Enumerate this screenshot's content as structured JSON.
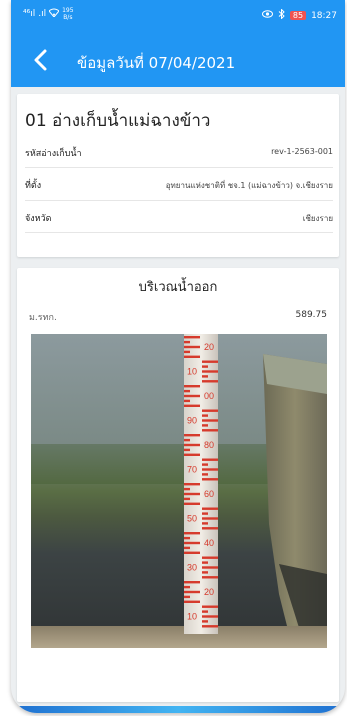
{
  "status_bar": {
    "signal1": "⁴⁶ıl",
    "signal2": ".ıl",
    "speed_value": "195",
    "speed_unit": "B/s",
    "battery": "85",
    "time": "18:27"
  },
  "header": {
    "title": "ข้อมูลวันที่ 07/04/2021"
  },
  "reservoir": {
    "name": "01 อ่างเก็บน้ำแม่ฉางข้าว",
    "fields": [
      {
        "label": "รหัสอ่างเก็บน้ำ",
        "value": "rev-1-2563-001"
      },
      {
        "label": "ที่ตั้ง",
        "value": "อุทยานแห่งชาติที่ ชจ.1 (แม่ฉางข้าว) จ.เชียงราย"
      },
      {
        "label": "จังหวัด",
        "value": "เชียงราย"
      }
    ]
  },
  "outlet": {
    "title": "บริเวณน้ำออก",
    "msl_label": "ม.รทก.",
    "msl_value": "589.75",
    "staff_gauge_labels": [
      "20",
      "10",
      "00",
      "90",
      "80",
      "70",
      "60",
      "50",
      "40",
      "30",
      "20",
      "10"
    ]
  },
  "colors": {
    "primary": "#2196f3",
    "background": "#eceff1",
    "gauge_red": "#d63a2c"
  }
}
